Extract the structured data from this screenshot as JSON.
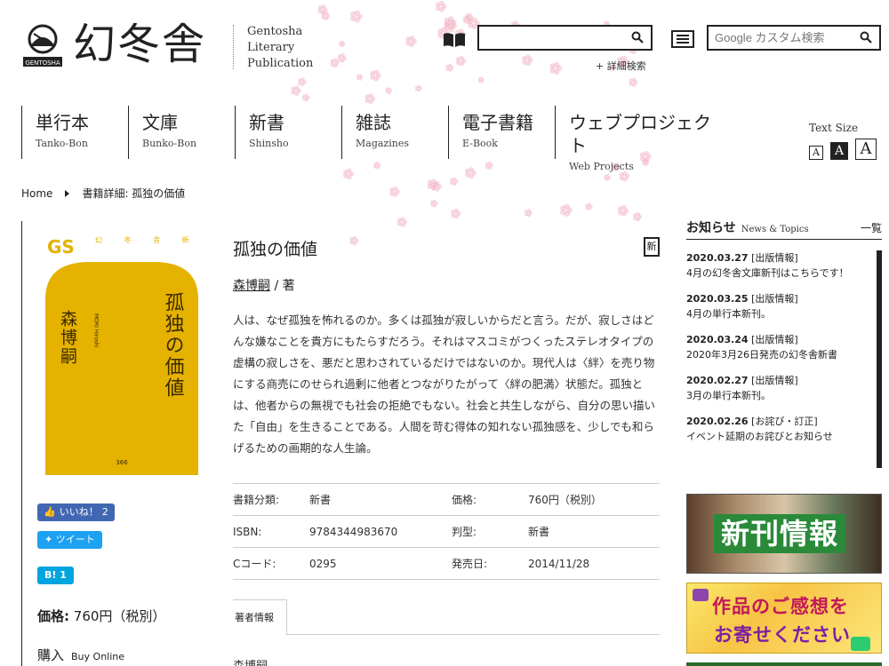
{
  "header": {
    "logo_text": "幻冬舎",
    "logo_sub": "GENTOSHA",
    "logo_en": [
      "Gentosha",
      "Literary",
      "Publication"
    ],
    "search_placeholder": "",
    "advanced_search": "+ 詳細検索",
    "google_search_placeholder": "Google カスタム検索"
  },
  "nav": [
    {
      "jp": "単行本",
      "en": "Tanko-Bon"
    },
    {
      "jp": "文庫",
      "en": "Bunko-Bon"
    },
    {
      "jp": "新書",
      "en": "Shinsho"
    },
    {
      "jp": "雑誌",
      "en": "Magazines"
    },
    {
      "jp": "電子書籍",
      "en": "E-Book"
    },
    {
      "jp": "ウェブプロジェクト",
      "en": "Web Projects"
    }
  ],
  "text_size": {
    "label": "Text Size",
    "buttons": [
      "A",
      "A",
      "A"
    ]
  },
  "breadcrumb": {
    "home": "Home",
    "current": "書籍詳細: 孤独の価値"
  },
  "cover": {
    "series": "GS",
    "series_small": "幻 冬 舎 新 書",
    "title": "孤独の価値",
    "author": "森博嗣",
    "author_romaji": "MORI Hiroshi",
    "number": "366"
  },
  "social": {
    "like": "いいね！",
    "like_count": "2",
    "tweet": "ツイート",
    "hatena": "B!",
    "hatena_count": "1"
  },
  "left": {
    "price_label": "価格:",
    "price_value": "760円（税別）",
    "buy": "購入",
    "buy_en": "Buy Online"
  },
  "book": {
    "title": "孤独の価値",
    "new_badge": "新",
    "author_name": "森博嗣",
    "author_role": " / 著",
    "description": "人は、なぜ孤独を怖れるのか。多くは孤独が寂しいからだと言う。だが、寂しさはどんな嫌なことを貴方にもたらすだろう。それはマスコミがつくったステレオタイプの虚構の寂しさを、悪だと思わされているだけではないのか。現代人は〈絆〉を売り物にする商売にのせられ過剰に他者とつながりたがって〈絆の肥満〉状態だ。孤独とは、他者からの無視でも社会の拒絶でもない。社会と共生しながら、自分の思い描いた「自由」を生きることである。人間を苛む得体の知れない孤独感を、少しでも和らげるための画期的な人生論。",
    "info": [
      {
        "k1": "書籍分類:",
        "v1": "新書",
        "k2": "価格:",
        "v2": "760円（税別）"
      },
      {
        "k1": "ISBN:",
        "v1": "9784344983670",
        "k2": "判型:",
        "v2": "新書"
      },
      {
        "k1": "Cコード:",
        "v1": "0295",
        "k2": "発売日:",
        "v2": "2014/11/28"
      }
    ],
    "tab": "著者情報",
    "tab_content": "森博嗣"
  },
  "news": {
    "title": "お知らせ",
    "title_en": "News & Topics",
    "all": "一覧",
    "items": [
      {
        "date": "2020.03.27",
        "tag": "[出版情報]",
        "text": "4月の幻冬舎文庫新刊はこちらです！"
      },
      {
        "date": "2020.03.25",
        "tag": "[出版情報]",
        "text": "4月の単行本新刊。"
      },
      {
        "date": "2020.03.24",
        "tag": "[出版情報]",
        "text": "2020年3月26日発売の幻冬舎新書"
      },
      {
        "date": "2020.02.27",
        "tag": "[出版情報]",
        "text": "3月の単行本新刊。"
      },
      {
        "date": "2020.02.26",
        "tag": "[お詫び・訂正]",
        "text": "イベント延期のお詫びとお知らせ"
      }
    ]
  },
  "banners": {
    "new_release": "新刊情報",
    "feedback_1": "作品のご感想を",
    "feedback_2": "お寄せください"
  },
  "colors": {
    "cover_yellow": "#e5b200",
    "fb": "#4267b2",
    "twitter": "#1da1f2",
    "hatena": "#00a4de",
    "blossom": "#f3b8c6"
  }
}
